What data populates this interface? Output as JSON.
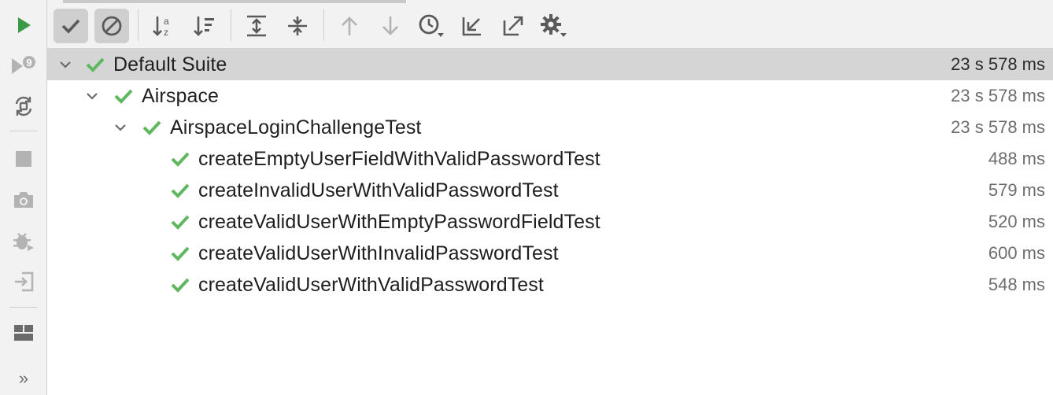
{
  "colors": {
    "pass": "#5fb85f",
    "run": "#3c9a47",
    "icon": "#6b6b6b",
    "icon_disabled": "#b3b3b3"
  },
  "side_toolbar": {
    "icons": [
      "run-icon",
      "rerun-failed-icon",
      "toggle-auto-test-icon",
      "stop-icon",
      "snapshot-icon",
      "debug-icon",
      "import-tests-icon",
      "layout-icon"
    ],
    "more_label": "»"
  },
  "top_toolbar": {
    "icons": [
      "show-passed-icon",
      "show-ignored-icon",
      "sort-alphabetically-icon",
      "sort-by-duration-icon",
      "expand-all-icon",
      "collapse-all-icon",
      "previous-failed-icon",
      "next-failed-icon",
      "test-history-icon",
      "import-icon",
      "export-icon",
      "settings-icon"
    ]
  },
  "tree": {
    "rows": [
      {
        "name": "Default Suite",
        "duration": "23 s 578 ms",
        "status": "passed",
        "expanded": true,
        "level": 0,
        "selected": true
      },
      {
        "name": "Airspace",
        "duration": "23 s 578 ms",
        "status": "passed",
        "expanded": true,
        "level": 1,
        "selected": false
      },
      {
        "name": "AirspaceLoginChallengeTest",
        "duration": "23 s 578 ms",
        "status": "passed",
        "expanded": true,
        "level": 2,
        "selected": false
      },
      {
        "name": "createEmptyUserFieldWithValidPasswordTest",
        "duration": "488 ms",
        "status": "passed",
        "level": 3,
        "selected": false
      },
      {
        "name": "createInvalidUserWithValidPasswordTest",
        "duration": "579 ms",
        "status": "passed",
        "level": 3,
        "selected": false
      },
      {
        "name": "createValidUserWithEmptyPasswordFieldTest",
        "duration": "520 ms",
        "status": "passed",
        "level": 3,
        "selected": false
      },
      {
        "name": "createValidUserWithInvalidPasswordTest",
        "duration": "600 ms",
        "status": "passed",
        "level": 3,
        "selected": false
      },
      {
        "name": "createValidUserWithValidPasswordTest",
        "duration": "548 ms",
        "status": "passed",
        "level": 3,
        "selected": false
      }
    ]
  }
}
